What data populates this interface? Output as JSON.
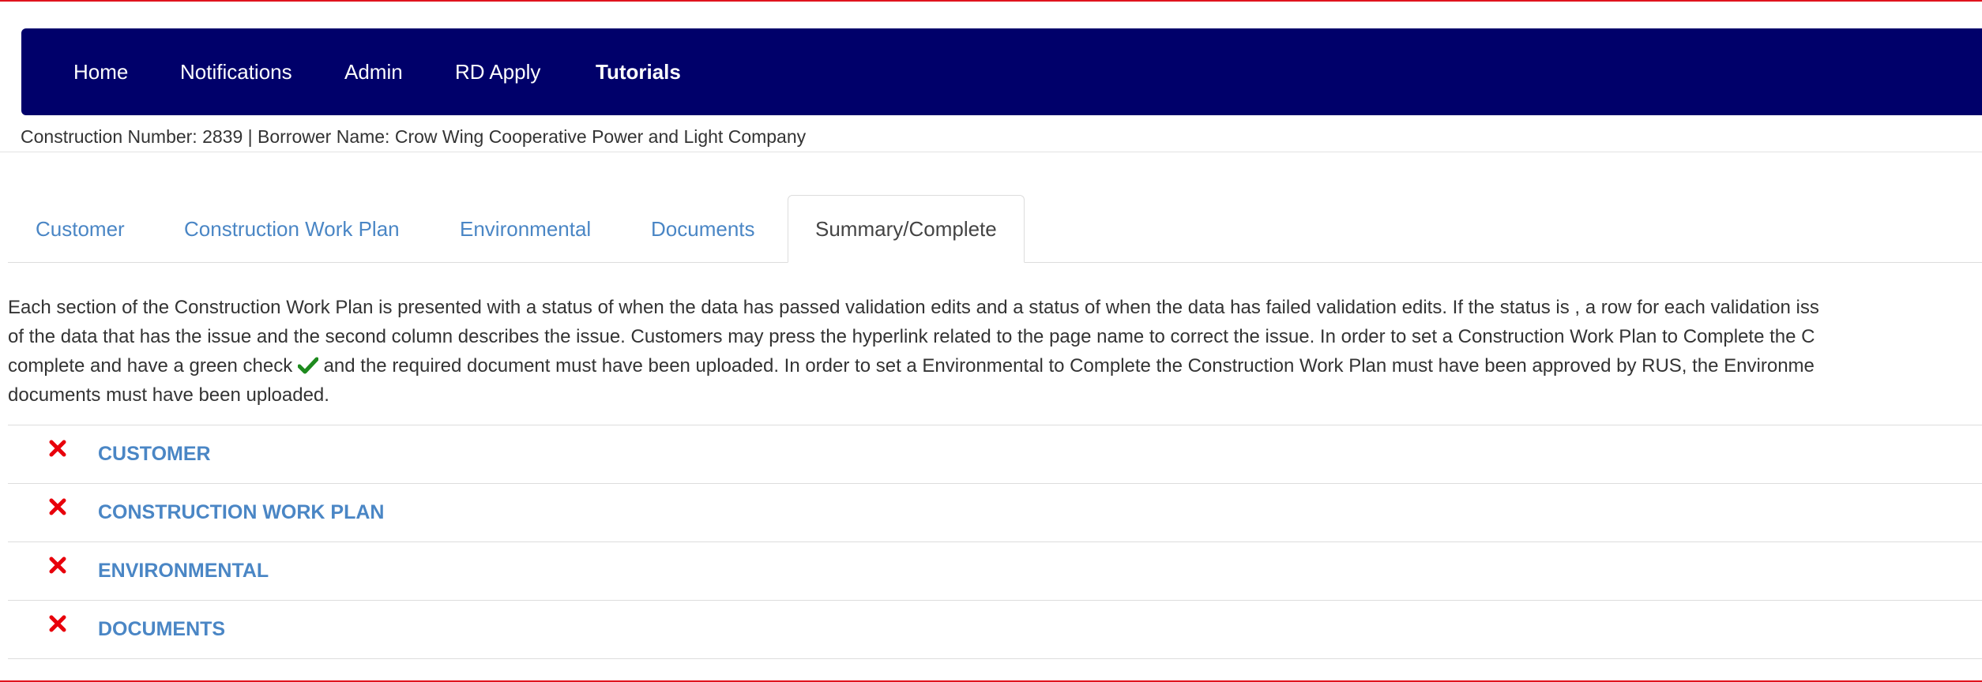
{
  "nav": {
    "items": [
      {
        "label": "Home"
      },
      {
        "label": "Notifications"
      },
      {
        "label": "Admin"
      },
      {
        "label": "RD Apply"
      },
      {
        "label": "Tutorials"
      }
    ]
  },
  "info_bar": "Construction Number: 2839 | Borrower Name: Crow Wing Cooperative Power and Light Company",
  "tabs": [
    {
      "label": "Customer"
    },
    {
      "label": "Construction Work Plan"
    },
    {
      "label": "Environmental"
    },
    {
      "label": "Documents"
    },
    {
      "label": "Summary/Complete",
      "active": true
    }
  ],
  "description": {
    "line1": "Each section of the Construction Work Plan is presented with a status of when the data has passed validation edits and a status of when the data has failed validation edits. If the status is , a row for each validation iss",
    "line2": "of the data that has the issue and the second column describes the issue. Customers may press the hyperlink related to the page name to correct the issue. In order to set a Construction Work Plan to Complete the C",
    "line3_before_check": "complete and have a green check ",
    "line3_check_icon": "green-check-icon",
    "line3_after_check": " and the required document must have been uploaded. In order to set a Environmental to Complete the Construction Work Plan must have been approved by RUS, the Environme",
    "line4": "documents must have been uploaded."
  },
  "sections": [
    {
      "label": "CUSTOMER",
      "status": "failed",
      "icon": "red-x-icon"
    },
    {
      "label": "CONSTRUCTION WORK PLAN",
      "status": "failed",
      "icon": "red-x-icon"
    },
    {
      "label": "ENVIRONMENTAL",
      "status": "failed",
      "icon": "red-x-icon"
    },
    {
      "label": "DOCUMENTS",
      "status": "failed",
      "icon": "red-x-icon"
    }
  ],
  "colors": {
    "navbar": "#00006a",
    "link": "#4a86c5",
    "failed_icon": "#e8000b",
    "check_icon": "#1e8a1e",
    "frame_border": "#e0141e"
  }
}
